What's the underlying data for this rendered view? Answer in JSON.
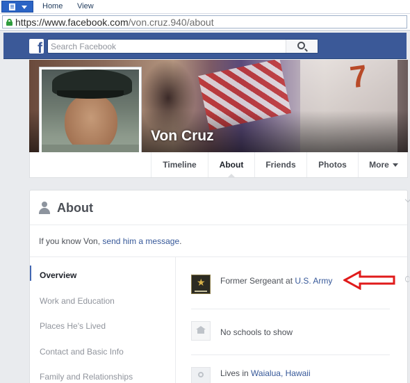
{
  "browser": {
    "menu": [
      {
        "label": "Home"
      },
      {
        "label": "View"
      }
    ],
    "url_host": "https://www.facebook.com",
    "url_path": "/von.cruz.940/about"
  },
  "facebook": {
    "logo_letter": "f",
    "search_placeholder": "Search Facebook"
  },
  "profile": {
    "name": "Von Cruz",
    "cover_number": "7"
  },
  "tabs": [
    {
      "label": "Timeline",
      "active": false
    },
    {
      "label": "About",
      "active": true
    },
    {
      "label": "Friends",
      "active": false
    },
    {
      "label": "Photos",
      "active": false
    },
    {
      "label": "More",
      "active": false
    }
  ],
  "about": {
    "title": "About",
    "message_prefix": "If you know Von, ",
    "message_link": "send him a message",
    "message_suffix": ".",
    "sidebar": [
      {
        "label": "Overview",
        "active": true
      },
      {
        "label": "Work and Education",
        "active": false
      },
      {
        "label": "Places He's Lived",
        "active": false
      },
      {
        "label": "Contact and Basic Info",
        "active": false
      },
      {
        "label": "Family and Relationships",
        "active": false
      }
    ],
    "overview": {
      "work_prefix": "Former Sergeant at ",
      "work_link": "U.S. Army",
      "schools": "No schools to show",
      "lives_prefix": "Lives in ",
      "lives_link": "Waialua, Hawaii"
    }
  },
  "colors": {
    "fb_blue": "#3b5998",
    "link": "#365899",
    "annotation_red": "#e01b1b"
  }
}
